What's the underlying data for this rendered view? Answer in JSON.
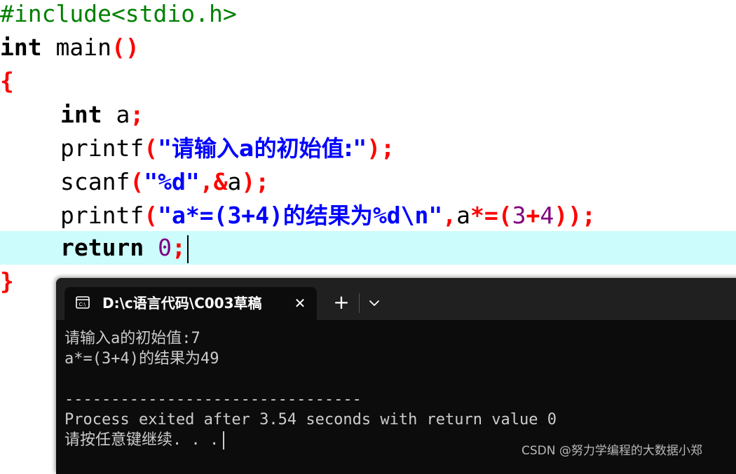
{
  "editor": {
    "line1": {
      "directive": "#include<stdio.h>"
    },
    "line2": {
      "type": "int",
      "name": " main",
      "parens": "()"
    },
    "line3": {
      "brace": "{"
    },
    "line4": {
      "type": "int",
      "rest": " a",
      "semi": ";"
    },
    "line5": {
      "fn": "printf",
      "open": "(",
      "q1": "\"",
      "str_a": "请输入a的初始值:",
      "q2": "\"",
      "close": ");"
    },
    "line6": {
      "fn": "scanf",
      "open": "(",
      "str": "\"%d\"",
      "comma": ",&",
      "var": "a",
      "close": ");"
    },
    "line7": {
      "fn": "printf",
      "open": "(",
      "q1": "\"",
      "str_a": "a*=(3+4)",
      "str_b": "的结果为",
      "str_c": "%d\\n",
      "q2": "\"",
      "comma": ",",
      "var": "a",
      "op": "*=(",
      "n1": "3",
      "plus": "+",
      "n2": "4",
      "close": "));"
    },
    "line8": {
      "kw": "return",
      "num": "0",
      "semi": ";"
    },
    "line9": {
      "brace": "}"
    }
  },
  "terminal": {
    "tab_title": "D:\\c语言代码\\C003草稿",
    "tab_icon": "console-icon",
    "close_glyph": "✕",
    "new_tab_glyph": "+",
    "lines": [
      "请输入a的初始值:7",
      "a*=(3+4)的结果为49",
      "",
      "--------------------------------",
      "Process exited after 3.54 seconds with return value 0",
      "请按任意键继续. . ."
    ]
  },
  "watermark": "CSDN @努力学编程的大数据小郑",
  "colors": {
    "current_line": "#ccfcfc",
    "punct": "#ff0000",
    "string": "#0000ff",
    "number": "#800080",
    "preprocessor": "#008000",
    "terminal_bg": "#0c0c0c",
    "tabbar_bg": "#202020"
  }
}
